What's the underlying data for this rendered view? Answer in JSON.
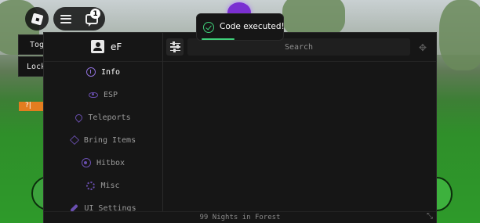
{
  "topbar": {
    "chat_badge": "1"
  },
  "side_buttons": {
    "toggle_label": "Toggle",
    "lock_label": "Lock"
  },
  "game": {
    "sign_text": "?|"
  },
  "window": {
    "title": "eF",
    "search_placeholder": "Search",
    "footer_text": "99 Nights in Forest"
  },
  "sidebar": {
    "items": [
      {
        "label": "Info",
        "icon": "info-icon",
        "active": true
      },
      {
        "label": "ESP",
        "icon": "eye-icon"
      },
      {
        "label": "Teleports",
        "icon": "map-pin-icon"
      },
      {
        "label": "Bring Items",
        "icon": "box-icon"
      },
      {
        "label": "Hitbox",
        "icon": "target-icon"
      },
      {
        "label": "Misc",
        "icon": "gear-icon"
      },
      {
        "label": "UI Settings",
        "icon": "wrench-icon"
      }
    ]
  },
  "toast": {
    "message": "Code executed!",
    "icon": "check-circle-icon"
  },
  "colors": {
    "accent": "#8e6fd8",
    "success": "#3fcf7a",
    "panel": "#161616"
  }
}
